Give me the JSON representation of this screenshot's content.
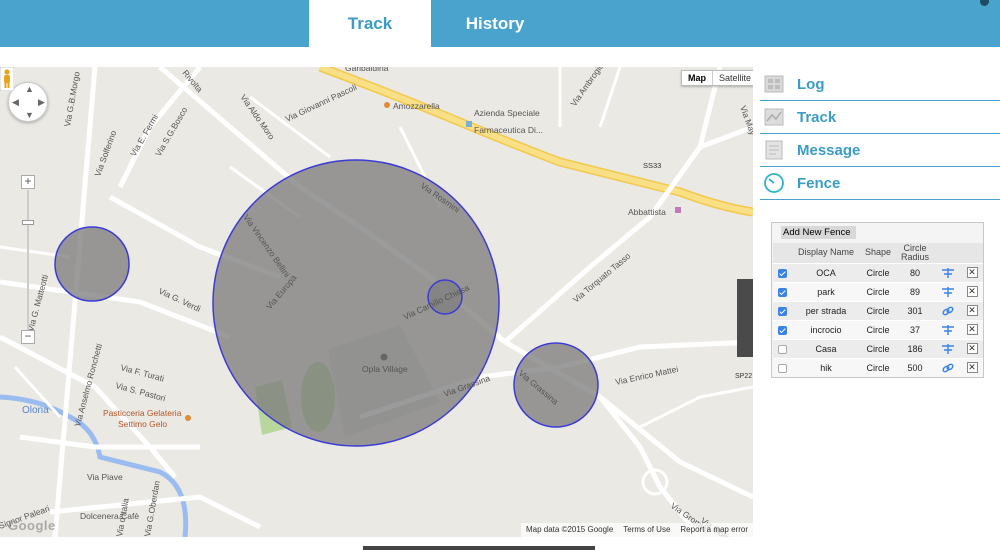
{
  "tabs": {
    "track": "Track",
    "history": "History"
  },
  "map": {
    "type_map": "Map",
    "type_satellite": "Satellite",
    "footer": [
      "Map data ©2015 Google",
      "Terms of Use",
      "Report a map error"
    ],
    "google_logo": "Google",
    "streets": [
      "Via G.B.Morgo",
      "Rivolta",
      "Via Giovanni Pascoli",
      "Via Ambrogio",
      "Via May",
      "Via Solferino",
      "Via E. Fermi",
      "Via S.G.Bosco",
      "Via Aldo Moro",
      "Garibaldina",
      "Amozzarella",
      "Azienda Speciale",
      "Farmaceutica Di...",
      "SS33",
      "Abbattista",
      "Via Rosmini",
      "Via Vincenzo Bellini",
      "Via Europa",
      "Via Camillo Chiesa",
      "Via G. Verdi",
      "Via G. Matteotti",
      "Via Torquato Tasso",
      "Opla Village",
      "Via Grassina",
      "Via Grassina",
      "Via Enrico Mattei",
      "SP22",
      "Via F. Turati",
      "Via S. Pastori",
      "Via Anselmo Ronchetti",
      "Pasticceria Gelateria",
      "Settimo Gelo",
      "Olona",
      "Via Piave",
      "Dolcenera Cafè",
      "Via G.Oberdan",
      "Via d'Italia",
      "Signor Paleari",
      "Via Gromia",
      "Via Molinara"
    ]
  },
  "menu": [
    {
      "label": "Log",
      "icon": "log-icon"
    },
    {
      "label": "Track",
      "icon": "track-icon"
    },
    {
      "label": "Message",
      "icon": "message-icon"
    },
    {
      "label": "Fence",
      "icon": "fence-icon"
    }
  ],
  "fence": {
    "add_label": "Add New Fence",
    "headers": {
      "name": "Display Name",
      "shape": "Shape",
      "radius": "Circle Radius"
    },
    "rows": [
      {
        "checked": true,
        "name": "OCA",
        "shape": "Circle",
        "radius": "80",
        "action": "pin-icon"
      },
      {
        "checked": true,
        "name": "park",
        "shape": "Circle",
        "radius": "89",
        "action": "pin-icon"
      },
      {
        "checked": true,
        "name": "per strada",
        "shape": "Circle",
        "radius": "301",
        "action": "link-icon"
      },
      {
        "checked": true,
        "name": "incrocio",
        "shape": "Circle",
        "radius": "37",
        "action": "pin-icon"
      },
      {
        "checked": false,
        "name": "Casa",
        "shape": "Circle",
        "radius": "186",
        "action": "pin-icon"
      },
      {
        "checked": false,
        "name": "hik",
        "shape": "Circle",
        "radius": "500",
        "action": "link-icon"
      }
    ]
  },
  "colors": {
    "accent": "#4aa3cc",
    "fence_fill": "#7f7f7f",
    "fence_stroke": "#3b3bd6",
    "highway": "#f7d25b"
  }
}
